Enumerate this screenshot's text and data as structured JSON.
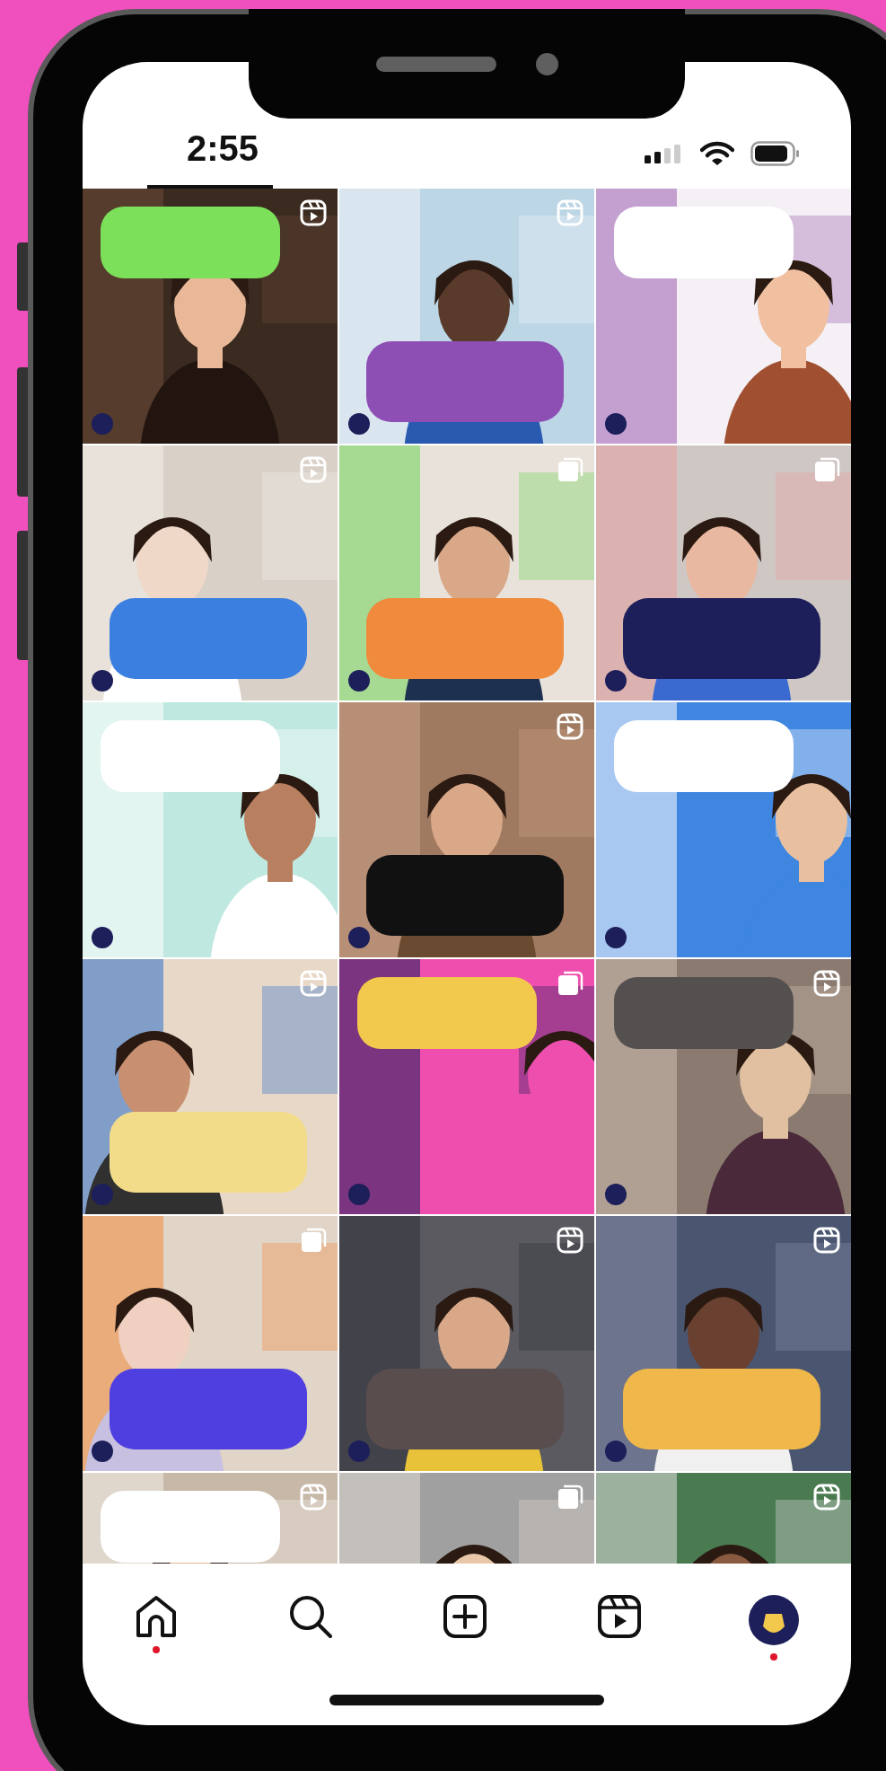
{
  "status_bar": {
    "time": "2:55"
  },
  "grid": {
    "tiles": [
      {
        "kind": "reel"
      },
      {
        "kind": "reel"
      },
      {
        "kind": "plain"
      },
      {
        "kind": "reel"
      },
      {
        "kind": "carousel"
      },
      {
        "kind": "carousel"
      },
      {
        "kind": "plain"
      },
      {
        "kind": "reel"
      },
      {
        "kind": "plain"
      },
      {
        "kind": "reel"
      },
      {
        "kind": "carousel"
      },
      {
        "kind": "reel"
      },
      {
        "kind": "carousel"
      },
      {
        "kind": "reel"
      },
      {
        "kind": "reel"
      },
      {
        "kind": "reel"
      },
      {
        "kind": "carousel"
      },
      {
        "kind": "reel"
      }
    ]
  },
  "nav": {
    "items": [
      {
        "kind": "home",
        "dot": true
      },
      {
        "kind": "search",
        "dot": false
      },
      {
        "kind": "create",
        "dot": false
      },
      {
        "kind": "reels",
        "dot": false
      },
      {
        "kind": "profile",
        "dot": true
      }
    ]
  }
}
